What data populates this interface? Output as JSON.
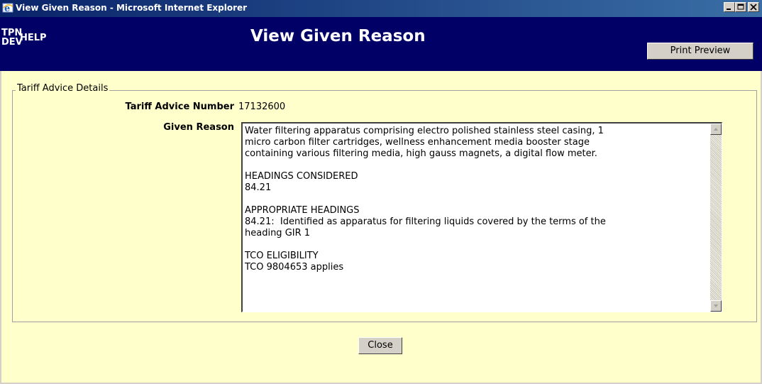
{
  "window": {
    "title": "View Given Reason - Microsoft Internet Explorer",
    "icon": "ie-icon",
    "controls": [
      "minimize-icon",
      "maximize-icon",
      "close-icon"
    ]
  },
  "header": {
    "logo_line1": "TPN",
    "logo_line2": "DEV",
    "help_label": "HELP",
    "page_title": "View Given Reason",
    "print_preview_label": "Print Preview"
  },
  "details": {
    "legend": "Tariff Advice Details",
    "tariff_advice_number_label": "Tariff Advice Number",
    "tariff_advice_number": "17132600",
    "given_reason_label": "Given Reason",
    "given_reason": "Water filtering apparatus comprising electro polished stainless steel casing, 1\nmicro carbon filter cartridges, wellness enhancement media booster stage\ncontaining various filtering media, high gauss magnets, a digital flow meter.\n\nHEADINGS CONSIDERED\n84.21\n\nAPPROPRIATE HEADINGS\n84.21:  Identified as apparatus for filtering liquids covered by the terms of the\nheading GIR 1\n\nTCO ELIGIBILITY\nTCO 9804653 applies"
  },
  "footer": {
    "close_label": "Close"
  },
  "colors": {
    "header_bg": "#000066",
    "page_bg": "#ffffcc",
    "titlebar_start": "#0a246a",
    "titlebar_end": "#3a6ea5"
  }
}
